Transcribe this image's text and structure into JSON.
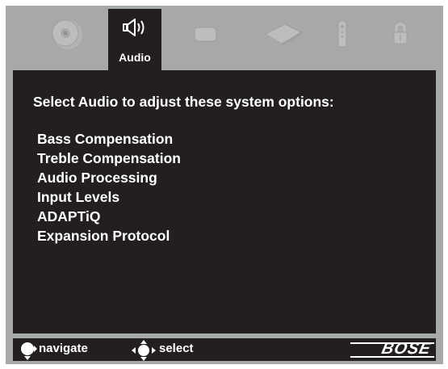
{
  "topbar": {
    "active_tab_label": "Audio",
    "icons": [
      "disc-icon",
      "speaker-icon",
      "screen-icon",
      "network-icon",
      "remote-icon",
      "lock-icon"
    ]
  },
  "main": {
    "heading": "Select Audio to adjust these system options:",
    "options": [
      "Bass Compensation",
      "Treble Compensation",
      "Audio Processing",
      "Input Levels",
      "ADAPTiQ",
      "Expansion Protocol"
    ]
  },
  "footer": {
    "navigate_label": "navigate",
    "select_label": "select",
    "brand": "BOSE"
  },
  "colors": {
    "frame": "#a7a8a9",
    "panel": "#231f20",
    "text": "#ffffff",
    "inactive_icon": "#b9babb"
  }
}
